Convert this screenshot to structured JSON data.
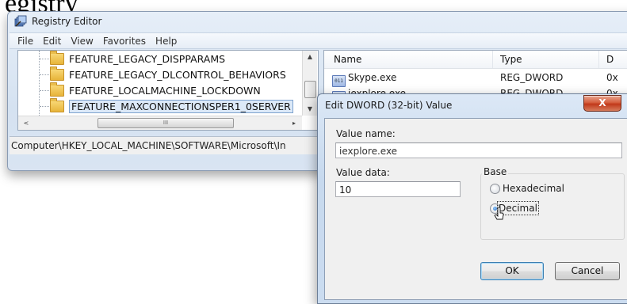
{
  "page": {
    "heading": "egistry"
  },
  "regedit": {
    "title": "Registry Editor",
    "menu": [
      "File",
      "Edit",
      "View",
      "Favorites",
      "Help"
    ],
    "tree": {
      "items": [
        {
          "label": "FEATURE_LEGACY_DISPPARAMS",
          "selected": false
        },
        {
          "label": "FEATURE_LEGACY_DLCONTROL_BEHAVIORS",
          "selected": false
        },
        {
          "label": "FEATURE_LOCALMACHINE_LOCKDOWN",
          "selected": false
        },
        {
          "label": "FEATURE_MAXCONNECTIONSPER1_0SERVER",
          "selected": true
        }
      ],
      "scroll_left": "<",
      "scroll_right": "▸",
      "scroll_thumb": "III"
    },
    "status_path": "Computer\\HKEY_LOCAL_MACHINE\\SOFTWARE\\Microsoft\\In",
    "list": {
      "headers": {
        "name": "Name",
        "type": "Type",
        "data": "D"
      },
      "rows": [
        {
          "name": "Skype.exe",
          "type": "REG_DWORD",
          "data": "0x"
        },
        {
          "name": "iexplore.exe",
          "type": "REG_DWORD",
          "data": "0x"
        }
      ]
    }
  },
  "dialog": {
    "title": "Edit DWORD (32-bit) Value",
    "close_label": "X",
    "value_name_label": "Value name:",
    "value_name": "iexplore.exe",
    "value_data_label": "Value data:",
    "value_data": "10",
    "base_label": "Base",
    "base_options": [
      {
        "label": "Hexadecimal",
        "checked": false
      },
      {
        "label": "Decimal",
        "checked": true
      }
    ],
    "ok_label": "OK",
    "cancel_label": "Cancel"
  }
}
